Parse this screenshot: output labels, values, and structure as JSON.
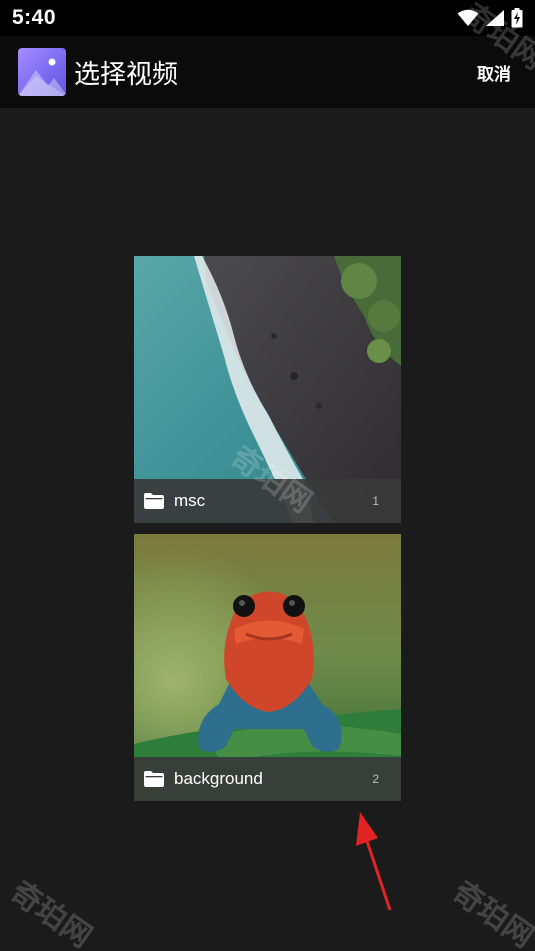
{
  "status_bar": {
    "time": "5:40",
    "icons": [
      "wifi-icon",
      "cellular-signal-icon",
      "battery-charging-icon"
    ]
  },
  "app_bar": {
    "icon": "gallery-app-icon",
    "title": "选择视频",
    "cancel_label": "取消"
  },
  "folders": [
    {
      "name": "msc",
      "count": "1",
      "icon": "folder-icon",
      "thumbnail": "aerial coastline"
    },
    {
      "name": "background",
      "count": "2",
      "icon": "folder-icon",
      "thumbnail": "red frog"
    }
  ],
  "watermark_text": "奇珀网",
  "colors": {
    "background": "#1b1b1b",
    "app_bar": "#0b0b0b",
    "caption_bg": "#3a3a3a",
    "app_icon_accent": "#7b6cf2",
    "annotation_arrow": "#e02424"
  }
}
